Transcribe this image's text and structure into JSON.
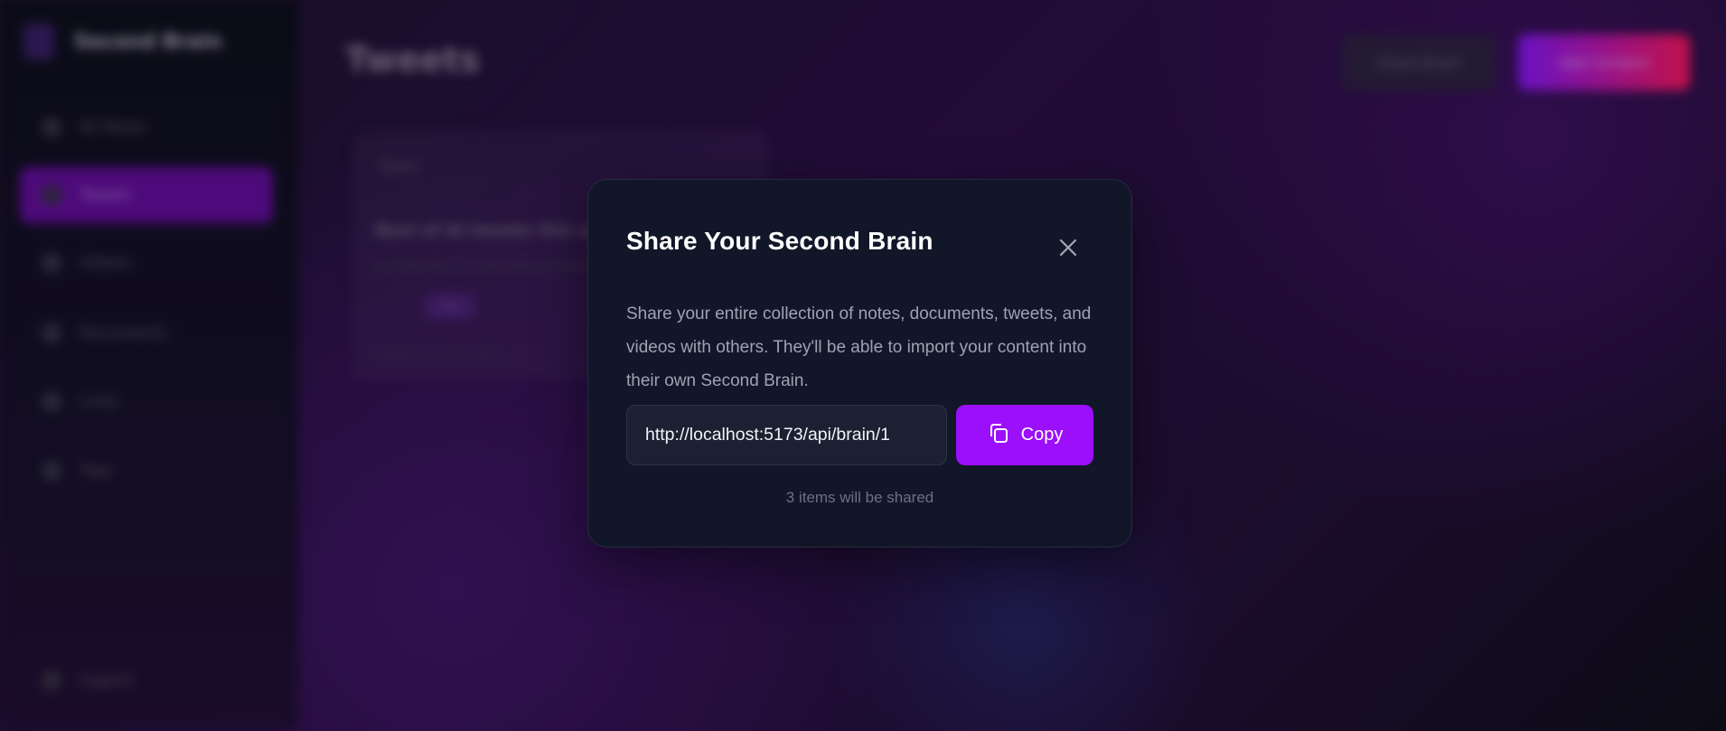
{
  "app": {
    "logo_text": "Second Brain",
    "sidebar": {
      "items": [
        {
          "label": "All Notes",
          "active": false
        },
        {
          "label": "Tweets",
          "active": true
        },
        {
          "label": "Videos",
          "active": false
        },
        {
          "label": "Documents",
          "active": false
        },
        {
          "label": "Links",
          "active": false
        },
        {
          "label": "Tags",
          "active": false
        }
      ],
      "logout_label": "Logout"
    },
    "header": {
      "title": "Tweets",
      "share_label": "Share Brain",
      "add_label": "Add Content"
    },
    "card": {
      "type_label": "Tweet",
      "title": "Best of AI tweets this week",
      "subtitle": "A collection of interesting threads",
      "tag": "#ai",
      "date": "Added on 01/01/2025"
    }
  },
  "modal": {
    "title": "Share Your Second Brain",
    "description": "Share your entire collection of notes, documents, tweets, and videos with others. They'll be able to import your content into their own Second Brain.",
    "share_link": "http://localhost:5173/api/brain/1",
    "copy_label": "Copy",
    "footnote": "3 items will be shared",
    "accent_color": "#9b0ffb"
  }
}
